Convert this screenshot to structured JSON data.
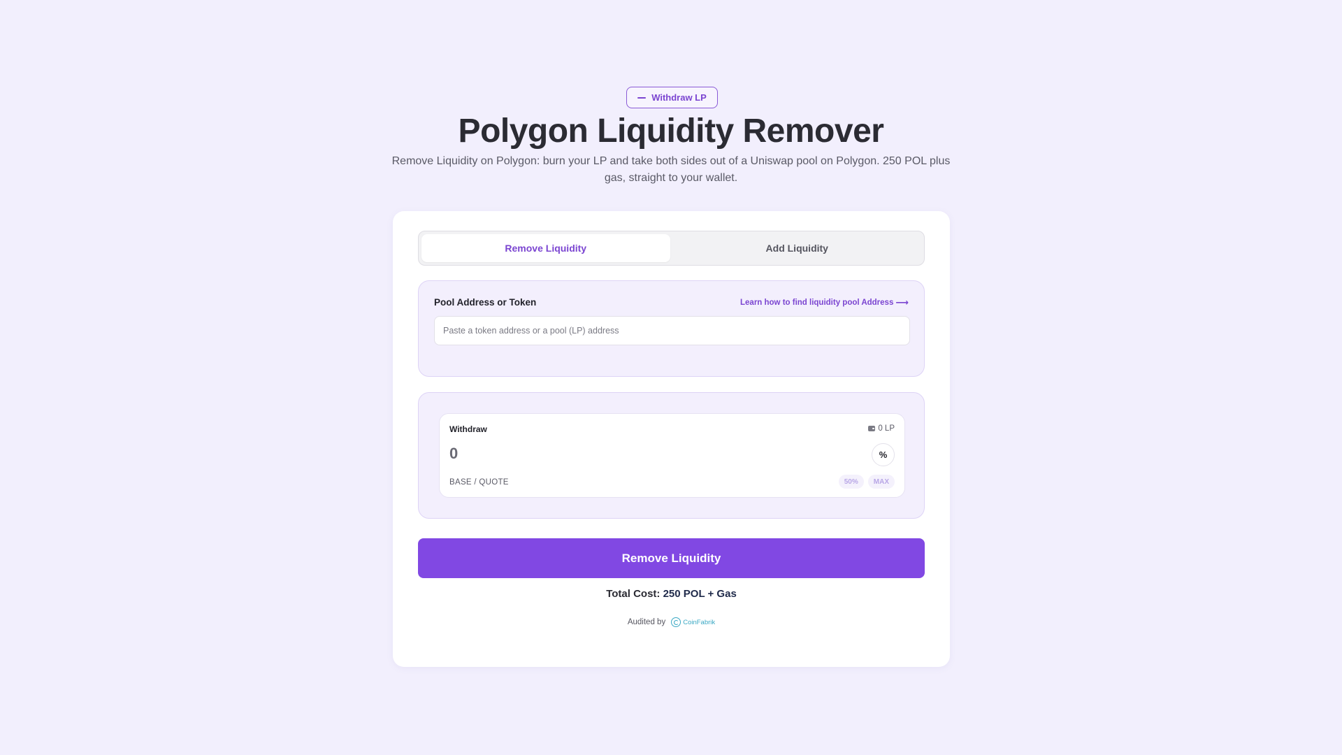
{
  "header": {
    "badge_label": "Withdraw LP",
    "badge_icon": "minus-icon",
    "title": "Polygon Liquidity Remover",
    "subtitle": "Remove Liquidity on Polygon: burn your LP and take both sides out of a Uniswap pool on Polygon. 250 POL plus gas, straight to your wallet."
  },
  "tabs": [
    {
      "label": "Remove Liquidity",
      "active": true
    },
    {
      "label": "Add Liquidity",
      "active": false
    }
  ],
  "pool": {
    "label": "Pool Address or Token",
    "learn_link": "Learn how to find liquidity pool Address",
    "learn_icon": "arrow-right-icon",
    "input_value": "",
    "input_placeholder": "Paste a token address or a pool (LP) address"
  },
  "withdraw": {
    "label": "Withdraw",
    "balance": "0 LP",
    "balance_icon": "wallet-icon",
    "amount": "0",
    "percent_button": "%",
    "pair": "BASE  /  QUOTE",
    "chips": [
      "50%",
      "MAX"
    ]
  },
  "cta": {
    "label": "Remove Liquidity"
  },
  "cost": {
    "prefix": "Total Cost:",
    "value": "250 POL + Gas"
  },
  "audit": {
    "label": "Audited by",
    "brand": "CoinFabrik",
    "brand_icon": "coinfabrik-logo-icon"
  },
  "colors": {
    "background": "#f2effd",
    "accent": "#8148e3",
    "accent_text": "#7b45d1",
    "panel": "#f3effd",
    "audit_brand": "#3aa8c4"
  }
}
